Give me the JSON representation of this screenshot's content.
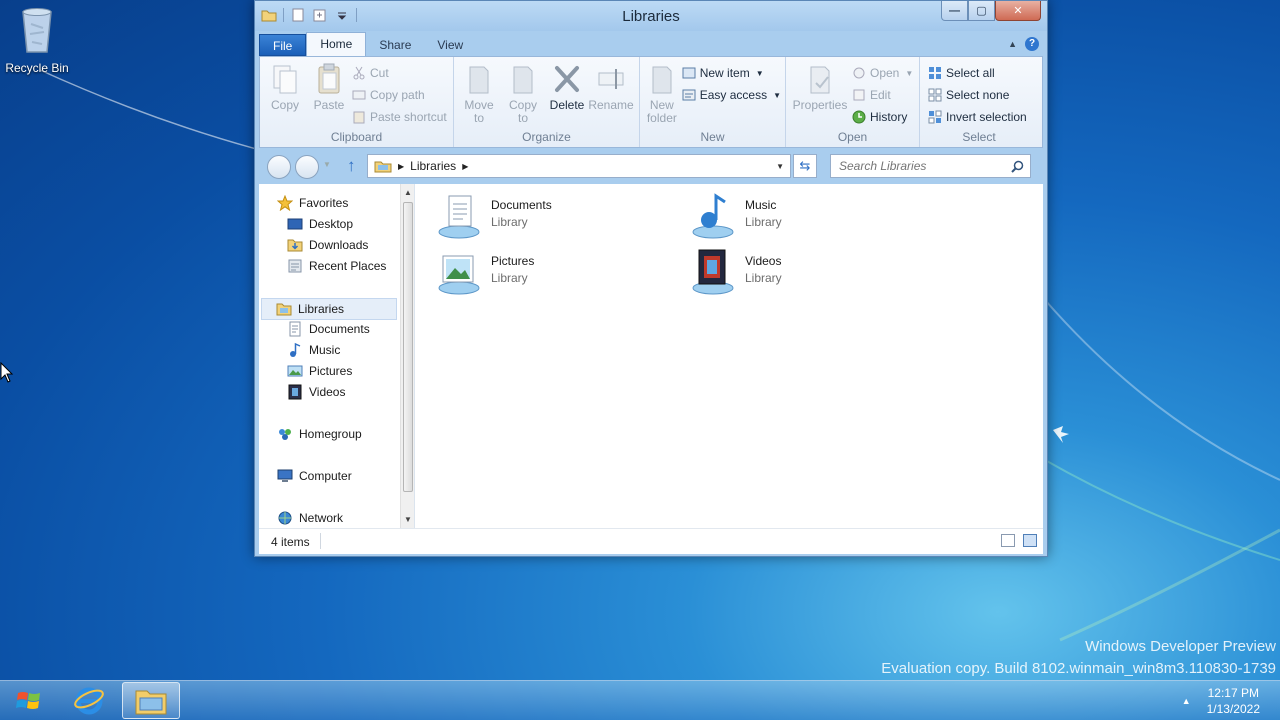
{
  "desktop": {
    "recycle_bin_label": "Recycle Bin",
    "watermark_line1": "Windows Developer Preview",
    "watermark_line2": "Evaluation copy. Build 8102.winmain_win8m3.110830-1739"
  },
  "window": {
    "title": "Libraries",
    "caption": {
      "minimize": "—",
      "maximize": "▢",
      "close": "✕"
    }
  },
  "ribbon": {
    "tabs": [
      {
        "label": "File"
      },
      {
        "label": "Home"
      },
      {
        "label": "Share"
      },
      {
        "label": "View"
      }
    ],
    "clipboard": {
      "label": "Clipboard",
      "copy": "Copy",
      "paste": "Paste",
      "cut": "Cut",
      "copy_path": "Copy path",
      "paste_shortcut": "Paste shortcut"
    },
    "organize": {
      "label": "Organize",
      "move_to": "Move\nto",
      "copy_to": "Copy\nto",
      "delete": "Delete",
      "rename": "Rename"
    },
    "new": {
      "label": "New",
      "new_folder": "New\nfolder",
      "new_item": "New item",
      "easy_access": "Easy access"
    },
    "open": {
      "label": "Open",
      "properties": "Properties",
      "open": "Open",
      "edit": "Edit",
      "history": "History"
    },
    "select": {
      "label": "Select",
      "select_all": "Select all",
      "select_none": "Select none",
      "invert_selection": "Invert selection"
    }
  },
  "address": {
    "path": "Libraries",
    "search_placeholder": "Search Libraries"
  },
  "nav": {
    "favorites": "Favorites",
    "desktop": "Desktop",
    "downloads": "Downloads",
    "recent_places": "Recent Places",
    "libraries": "Libraries",
    "documents": "Documents",
    "music": "Music",
    "pictures": "Pictures",
    "videos": "Videos",
    "homegroup": "Homegroup",
    "computer": "Computer",
    "network": "Network"
  },
  "libraries": [
    {
      "name": "Documents",
      "type": "Library"
    },
    {
      "name": "Music",
      "type": "Library"
    },
    {
      "name": "Pictures",
      "type": "Library"
    },
    {
      "name": "Videos",
      "type": "Library"
    }
  ],
  "status": {
    "item_count": "4 items"
  },
  "taskbar": {
    "time": "12:17 PM",
    "date": "1/13/2022"
  }
}
